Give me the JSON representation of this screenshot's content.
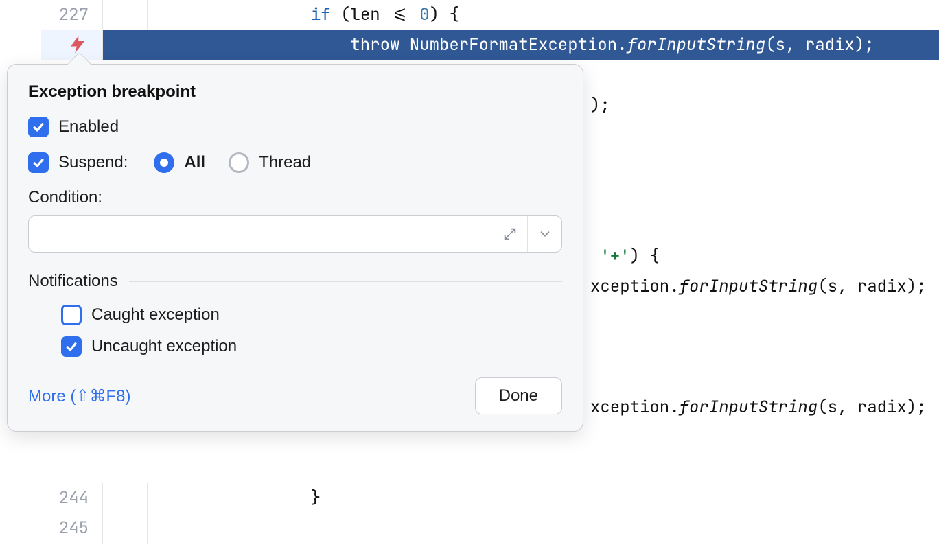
{
  "code": {
    "line227_number": "227",
    "line227_a": "if",
    "line227_b": " (len <= ",
    "line227_c": "0",
    "line227_d": ") {",
    "line228_a": "throw",
    "line228_b": " NumberFormatException.",
    "line228_c": "forInputString",
    "line228_d": "(s, radix);",
    "frag_paren": ");",
    "frag_plus_a": "'+'",
    "frag_plus_b": ") {",
    "frag_ex_a": "xception.",
    "frag_ex_b": "forInputString",
    "frag_ex_c": "(s, radix);",
    "line244_number": "244",
    "line244_code": "}",
    "line245_number": "245"
  },
  "popup": {
    "title": "Exception breakpoint",
    "enabled_label": "Enabled",
    "suspend_label": "Suspend:",
    "radio_all": "All",
    "radio_thread": "Thread",
    "condition_label": "Condition:",
    "condition_value": "",
    "notifications_label": "Notifications",
    "caught_label": "Caught exception",
    "uncaught_label": "Uncaught exception",
    "more_link": "More (⇧⌘F8)",
    "done_button": "Done"
  }
}
